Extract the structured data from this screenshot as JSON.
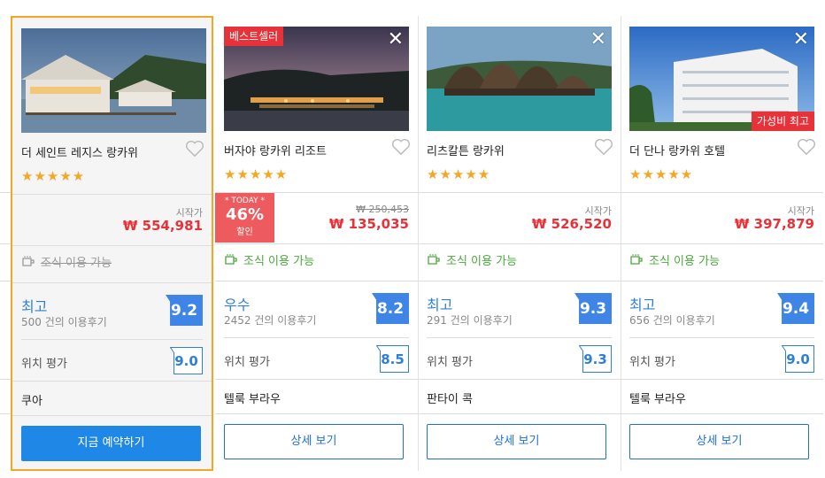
{
  "hotels": [
    {
      "name": "더 세인트 레지스 랑카위",
      "stars": "★★★★★",
      "price_label": "시작가",
      "price": "₩ 554,981",
      "breakfast": "조식 이용 가능",
      "rating_word": "최고",
      "reviews": "500 건의 이용후기",
      "score": "9.2",
      "location_label": "위치 평가",
      "location_score": "9.0",
      "area": "쿠아",
      "button": "지금 예약하기"
    },
    {
      "name": "버자야 랑카위 리조트",
      "badge": "베스트셀러",
      "close": "✕",
      "stars": "★★★★★",
      "today": {
        "label": "* TODAY *",
        "pct": "46%",
        "sub": "할인"
      },
      "old_price": "₩ 250,453",
      "price": "₩ 135,035",
      "breakfast": "조식 이용 가능",
      "rating_word": "우수",
      "reviews": "2452 건의 이용후기",
      "score": "8.2",
      "location_label": "위치 평가",
      "location_score": "8.5",
      "area": "텔룩 부라우",
      "button": "상세 보기"
    },
    {
      "name": "리츠칼튼 랑카위",
      "close": "✕",
      "stars": "★★★★★",
      "price_label": "시작가",
      "price": "₩ 526,520",
      "breakfast": "조식 이용 가능",
      "rating_word": "최고",
      "reviews": "291 건의 이용후기",
      "score": "9.3",
      "location_label": "위치 평가",
      "location_score": "9.3",
      "area": "판타이 콕",
      "button": "상세 보기"
    },
    {
      "name": "더 단나 랑카위 호텔",
      "badge": "가성비 최고",
      "close": "✕",
      "stars": "★★★★★",
      "price_label": "시작가",
      "price": "₩ 397,879",
      "breakfast": "조식 이용 가능",
      "rating_word": "최고",
      "reviews": "656 건의 이용후기",
      "score": "9.4",
      "location_label": "위치 평가",
      "location_score": "9.0",
      "area": "텔룩 부라우",
      "button": "상세 보기"
    }
  ],
  "colors": {
    "accent": "#1f87e5",
    "price": "#e8323a",
    "rating": "#2f7fd8",
    "breakfast": "#4aa83b",
    "selected_border": "#f5a623"
  },
  "icons": [
    "close-icon",
    "heart-icon",
    "coffee-cup-icon",
    "star-icon"
  ]
}
